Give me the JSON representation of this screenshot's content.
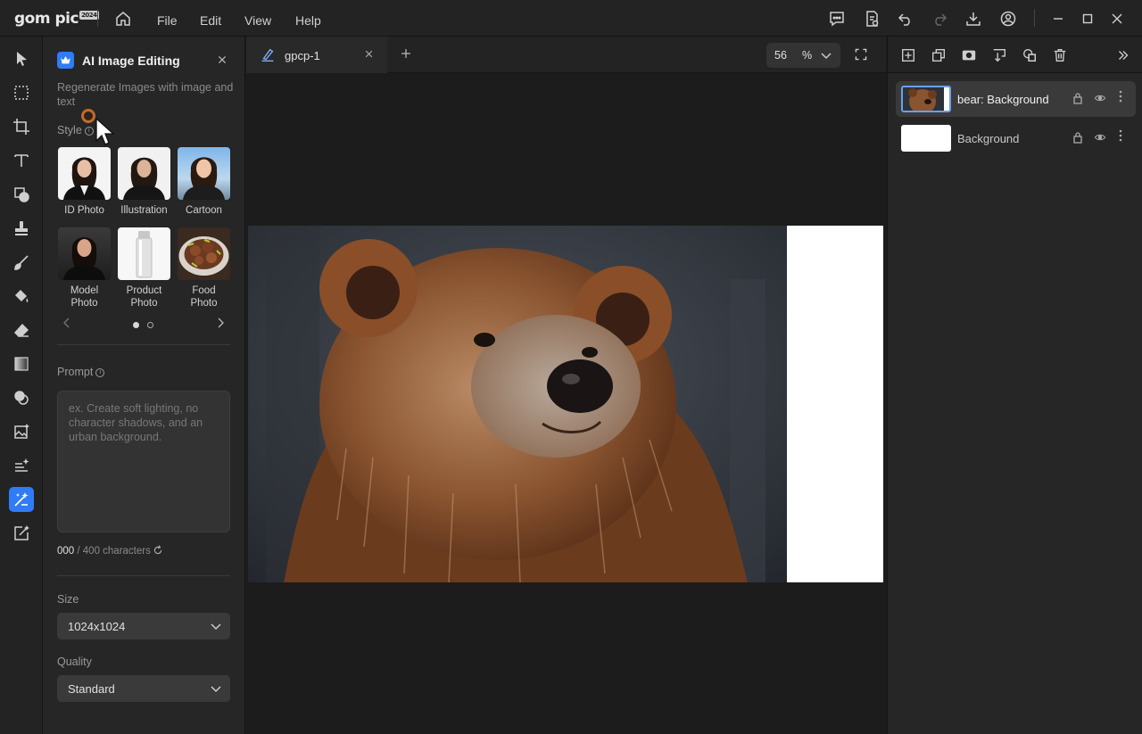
{
  "app": {
    "logo": "gom pic",
    "logo_year": "2024",
    "menu": [
      "File",
      "Edit",
      "View",
      "Help"
    ]
  },
  "ai_panel": {
    "title": "AI Image Editing",
    "description": "Regenerate Images with image and text",
    "style_label": "Style",
    "styles": [
      {
        "label": "ID Photo"
      },
      {
        "label": "Illustration"
      },
      {
        "label": "Cartoon"
      },
      {
        "label": "Model Photo"
      },
      {
        "label": "Product Photo"
      },
      {
        "label": "Food Photo"
      }
    ],
    "carousel_page": 1,
    "carousel_pages": 2,
    "prompt_label": "Prompt",
    "prompt_placeholder": "ex. Create soft lighting, no character shadows, and an urban background.",
    "char_count": "000",
    "char_limit": "/ 400 characters",
    "size_label": "Size",
    "size_value": "1024x1024",
    "quality_label": "Quality",
    "quality_value": "Standard"
  },
  "document": {
    "tab_name": "gpcp-1",
    "zoom_value": "56",
    "zoom_unit": "%"
  },
  "layers": [
    {
      "name": "bear: Background",
      "selected": true
    },
    {
      "name": "Background",
      "selected": false
    }
  ],
  "colors": {
    "accent": "#2f7cf6",
    "panel": "#262627",
    "canvas": "#1c1c1d"
  }
}
